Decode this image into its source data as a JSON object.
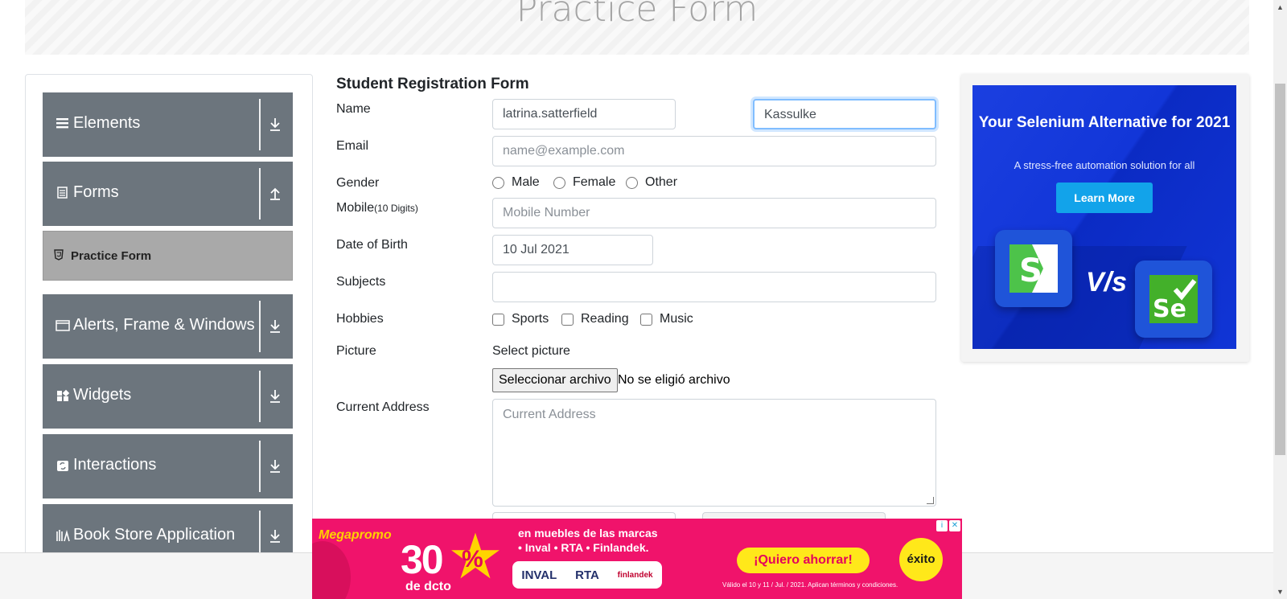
{
  "header": {
    "title": "Practice Form"
  },
  "sidebar": {
    "groups": [
      {
        "label": "Elements",
        "icon": "hamburger-icon",
        "arrow": "down"
      },
      {
        "label": "Forms",
        "icon": "document-icon",
        "arrow": "up"
      },
      {
        "label": "Alerts, Frame & Windows",
        "icon": "window-icon",
        "arrow": "down"
      },
      {
        "label": "Widgets",
        "icon": "widgets-icon",
        "arrow": "down"
      },
      {
        "label": "Interactions",
        "icon": "refresh-icon",
        "arrow": "down"
      },
      {
        "label": "Book Store Application",
        "icon": "books-icon",
        "arrow": "down"
      }
    ],
    "active_item": {
      "label": "Practice Form",
      "icon": "html5-icon"
    }
  },
  "form": {
    "title": "Student Registration Form",
    "name_label": "Name",
    "first_name": "latrina.satterfield",
    "last_name": "Kassulke",
    "email_label": "Email",
    "email_placeholder": "name@example.com",
    "gender_label": "Gender",
    "genders": [
      "Male",
      "Female",
      "Other"
    ],
    "mobile_label": "Mobile",
    "mobile_hint": "(10 Digits)",
    "mobile_placeholder": "Mobile Number",
    "dob_label": "Date of Birth",
    "dob_value": "10 Jul 2021",
    "subjects_label": "Subjects",
    "hobbies_label": "Hobbies",
    "hobbies": [
      "Sports",
      "Reading",
      "Music"
    ],
    "picture_label": "Picture",
    "select_picture": "Select picture",
    "file_button": "Seleccionar archivo",
    "file_status": "No se eligió archivo",
    "address_label": "Current Address",
    "address_placeholder": "Current Address"
  },
  "right_ad": {
    "headline": "Your Selenium Alternative for 2021",
    "subline": "A stress-free automation solution for all",
    "cta": "Learn More",
    "vs": "V/s",
    "logo_left": "S",
    "logo_right": "Se"
  },
  "bottom_ad": {
    "brand": "Megapromo",
    "percent": "30",
    "percent_sign": "%",
    "dcto": "de dcto",
    "line1": "en muebles de las marcas",
    "line2": "• Inval • RTA • Finlandek.",
    "brands": [
      "INVAL",
      "RTA",
      "finlandek"
    ],
    "cta": "¡Quiero ahorrar!",
    "legal": "Válido el 10 y 11 / Jul. / 2021. Aplican términos y condiciones.",
    "store": "éxito"
  },
  "colors": {
    "sidebar_bg": "#6c757d",
    "active_bg": "#a9a9a9",
    "ad_blue": "#1236d8",
    "ad_pink": "#f0136b",
    "focus": "#80bdff"
  }
}
